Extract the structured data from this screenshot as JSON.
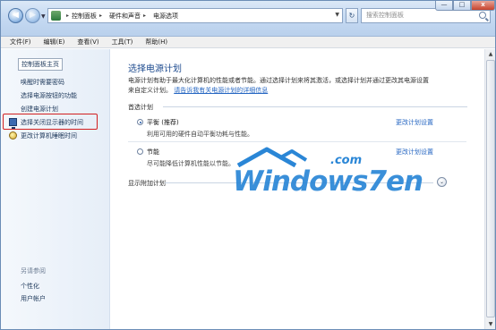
{
  "window": {
    "controls": {
      "minimize": "—",
      "maximize": "□",
      "close": "x"
    }
  },
  "address": {
    "breadcrumbs": [
      "控制面板",
      "硬件和声音",
      "电源选项"
    ],
    "icon": "control-panel-icon"
  },
  "search": {
    "placeholder": "搜索控制面板"
  },
  "menu": {
    "items": [
      "文件(F)",
      "编辑(E)",
      "查看(V)",
      "工具(T)",
      "帮助(H)"
    ]
  },
  "sidebar": {
    "home": "控制面板主页",
    "links": [
      "唤醒时需要密码",
      "选择电源按钮的功能",
      "创建电源计划",
      "选择关闭显示器的时间",
      "更改计算机睡眠时间"
    ],
    "see_also": "另请参阅",
    "see_also_links": [
      "个性化",
      "用户帐户"
    ],
    "highlight_color": "#d11f1f"
  },
  "main": {
    "title": "选择电源计划",
    "description_line1": "电源计划有助于最大化计算机的性能或者节能。通过选择计划来将其激活，或选择计划并通过更改其电源设置",
    "description_line2": "来自定义计划。",
    "description_link": "请告诉我有关电源计划的详细信息",
    "section_label": "首选计划",
    "plans": [
      {
        "name": "平衡 (推荐)",
        "desc": "利用可用的硬件自动平衡功耗与性能。",
        "link": "更改计划设置",
        "selected": true
      },
      {
        "name": "节能",
        "desc": "尽可能降低计算机性能以节能。",
        "link": "更改计划设置",
        "selected": false
      }
    ],
    "show_more": "显示附加计划"
  },
  "watermark": {
    "text": "Windows7en",
    "suffix": ".com",
    "color": "#2a86d6"
  }
}
